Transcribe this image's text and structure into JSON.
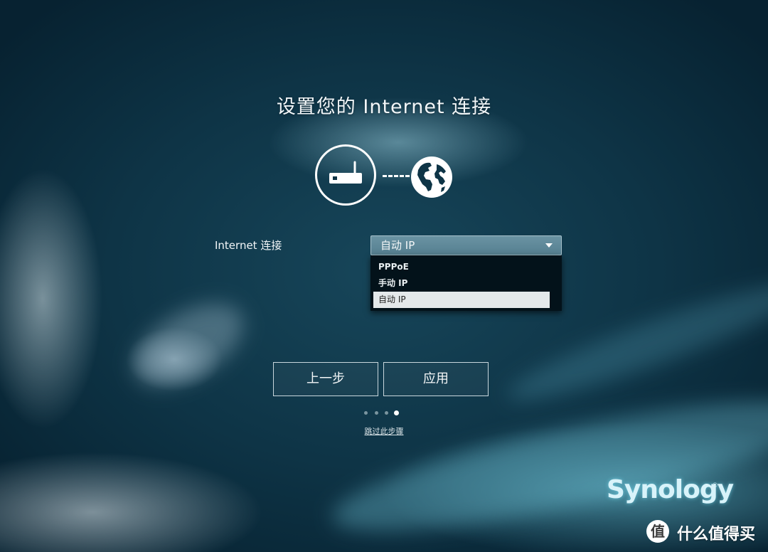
{
  "wizard": {
    "title": "设置您的 Internet 连接"
  },
  "form": {
    "connection_label": "Internet 连接",
    "connection_value": "自动 IP",
    "options": [
      "PPPoE",
      "手动 IP",
      "自动 IP"
    ],
    "selected_option_index": 2
  },
  "buttons": {
    "back_label": "上一步",
    "apply_label": "应用"
  },
  "pager": {
    "total_steps": 4,
    "current_step": 4
  },
  "skip_label": "跳过此步骤",
  "brand": {
    "logo_text": "Synology",
    "logo_mark": "®"
  },
  "watermark": {
    "icon_char": "值",
    "text": "什么值得买"
  },
  "colors": {
    "background": "#0e3446",
    "select_fill": "#6a93a3",
    "dropdown_bg": "#03121a",
    "selected_option_bg": "#e4e8ea"
  },
  "icons": {
    "router": "router-icon",
    "globe": "globe-icon",
    "dropdown_arrow": "caret-down-icon"
  }
}
